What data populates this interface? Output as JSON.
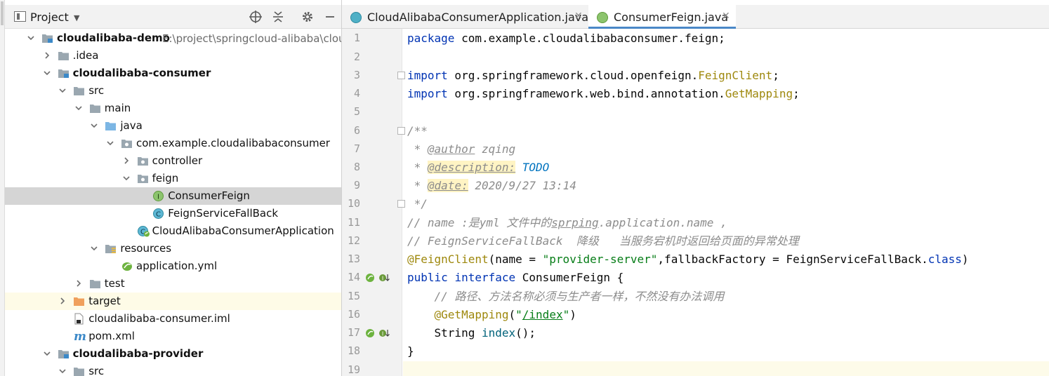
{
  "project_panel": {
    "title": "Project",
    "tree": [
      {
        "label": "cloudalibaba-demo",
        "path": "E:\\project\\springcloud-alibaba\\cloudalibaba-demo",
        "bold": true,
        "indent": 0,
        "arrow": "down",
        "icon": "module"
      },
      {
        "label": ".idea",
        "indent": 1,
        "arrow": "right",
        "icon": "folder"
      },
      {
        "label": "cloudalibaba-consumer",
        "bold": true,
        "indent": 1,
        "arrow": "down",
        "icon": "module"
      },
      {
        "label": "src",
        "indent": 2,
        "arrow": "down",
        "icon": "folder"
      },
      {
        "label": "main",
        "indent": 3,
        "arrow": "down",
        "icon": "folder"
      },
      {
        "label": "java",
        "indent": 4,
        "arrow": "down",
        "icon": "source-folder"
      },
      {
        "label": "com.example.cloudalibabaconsumer",
        "indent": 5,
        "arrow": "down",
        "icon": "package"
      },
      {
        "label": "controller",
        "indent": 6,
        "arrow": "right",
        "icon": "package"
      },
      {
        "label": "feign",
        "indent": 6,
        "arrow": "down",
        "icon": "package"
      },
      {
        "label": "ConsumerFeign",
        "indent": 7,
        "arrow": "none",
        "icon": "interface",
        "selected": true
      },
      {
        "label": "FeignServiceFallBack",
        "indent": 7,
        "arrow": "none",
        "icon": "class"
      },
      {
        "label": "CloudAlibabaConsumerApplication",
        "indent": 6,
        "arrow": "none",
        "icon": "spring-class"
      },
      {
        "label": "resources",
        "indent": 4,
        "arrow": "down",
        "icon": "resources-folder"
      },
      {
        "label": "application.yml",
        "indent": 5,
        "arrow": "none",
        "icon": "spring-yml"
      },
      {
        "label": "test",
        "indent": 3,
        "arrow": "right",
        "icon": "folder"
      },
      {
        "label": "target",
        "indent": 2,
        "arrow": "right",
        "icon": "excluded-folder",
        "highlight": true
      },
      {
        "label": "cloudalibaba-consumer.iml",
        "indent": 2,
        "arrow": "none",
        "icon": "iml-file"
      },
      {
        "label": "pom.xml",
        "indent": 2,
        "arrow": "none",
        "icon": "maven"
      },
      {
        "label": "cloudalibaba-provider",
        "bold": true,
        "indent": 1,
        "arrow": "down",
        "icon": "module"
      },
      {
        "label": "src",
        "indent": 2,
        "arrow": "down",
        "icon": "folder"
      }
    ]
  },
  "editor": {
    "tabs": [
      {
        "label": "CloudAlibabaConsumerApplication.java",
        "icon": "spring-class",
        "active": false
      },
      {
        "label": "ConsumerFeign.java",
        "icon": "interface",
        "active": true
      }
    ],
    "line_numbers": [
      "1",
      "2",
      "3",
      "4",
      "5",
      "6",
      "7",
      "8",
      "9",
      "10",
      "11",
      "12",
      "13",
      "14",
      "15",
      "16",
      "17",
      "18",
      "19"
    ],
    "code": {
      "l1_kw": "package",
      "l1_rest": " com.example.cloudalibabaconsumer.feign;",
      "l3_kw": "import",
      "l3_rest": " org.springframework.cloud.openfeign.",
      "l3_ann": "FeignClient",
      "l3_end": ";",
      "l4_kw": "import",
      "l4_rest": " org.springframework.web.bind.annotation.",
      "l4_ann": "GetMapping",
      "l4_end": ";",
      "l6": "/**",
      "l7_pre": " * ",
      "l7_tag": "@author",
      "l7_val": " zqing",
      "l8_pre": " * ",
      "l8_tag": "@description:",
      "l8_val": " TODO",
      "l9_pre": " * ",
      "l9_tag": "@date:",
      "l9_val": " 2020/9/27 13:14",
      "l10": " */",
      "l11_a": "// name :是yml 文件中的",
      "l11_b": "sprping",
      "l11_c": ".application.name ,",
      "l12": "// FeignServiceFallBack  降级   当服务宕机时返回给页面的异常处理",
      "l13_ann": "@FeignClient",
      "l13_a": "(name = ",
      "l13_str": "\"provider-server\"",
      "l13_b": ",fallbackFactory = FeignServiceFallBack.",
      "l13_kw": "class",
      "l13_c": ")",
      "l14_kw1": "public",
      "l14_kw2": "interface",
      "l14_rest": " ConsumerFeign {",
      "l15": "    // 路径、方法名称必须与生产者一样，不然没有办法调用",
      "l16_ann": "@GetMapping",
      "l16_a": "(",
      "l16_q1": "\"",
      "l16_path": "/index",
      "l16_q2": "\"",
      "l16_b": ")",
      "l17_a": "    String ",
      "l17_meth": "index",
      "l17_b": "();",
      "l18": "}"
    }
  }
}
